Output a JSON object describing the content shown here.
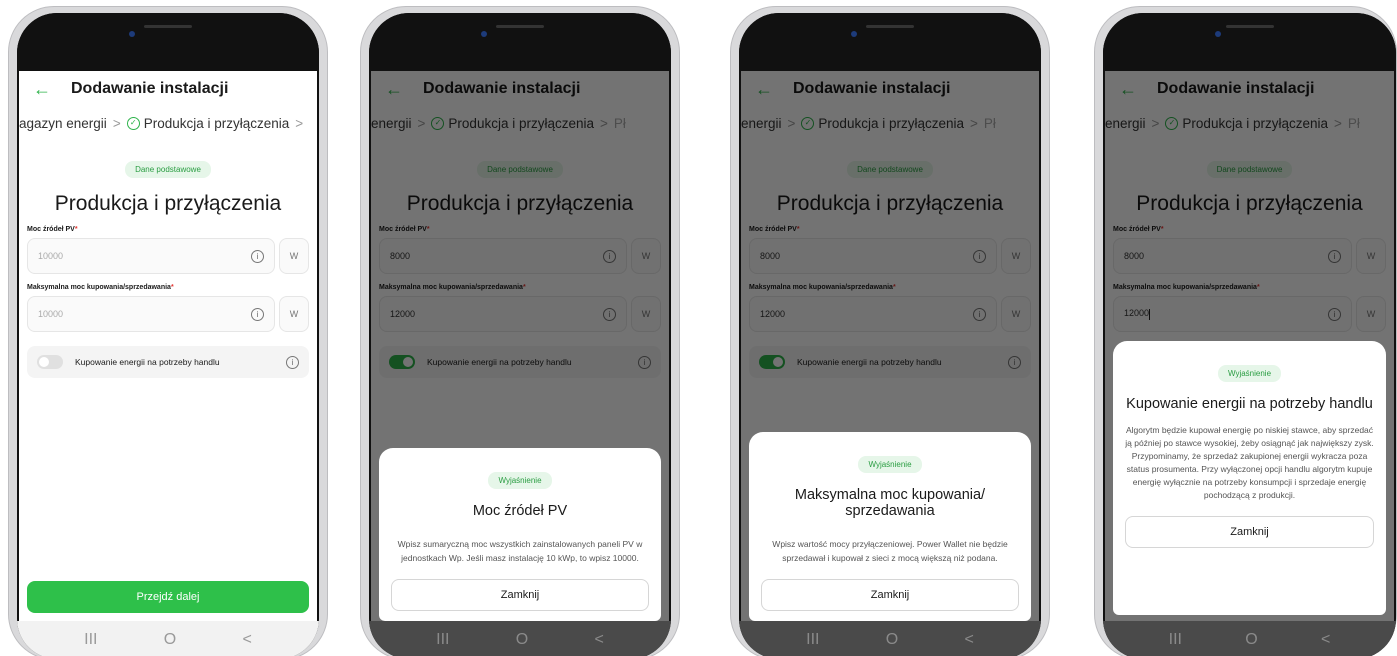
{
  "app": {
    "title": "Dodawanie instalacji",
    "back_icon": "arrow-left-icon",
    "accent": "#2db34a"
  },
  "breadcrumb": {
    "prev": "Magazyn energii",
    "prev_short_1": "agazyn energii",
    "prev_short_2": "energii",
    "current": "Produkcja i przyłączenia",
    "next_short": "Pł"
  },
  "form": {
    "badge": "Dane podstawowe",
    "heading": "Produkcja i przyłączenia",
    "pv_label": "Moc źródeł PV",
    "pv_placeholder": "10000",
    "pv_value": "8000",
    "max_label": "Maksymalna moc kupowania/sprzedawania",
    "max_placeholder": "10000",
    "max_value": "12000",
    "unit": "W",
    "toggle_label": "Kupowanie energii na potrzeby handlu",
    "next_button": "Przejdź dalej"
  },
  "nav": {
    "recent": "III",
    "home": "O",
    "back": "<"
  },
  "sheets": {
    "badge": "Wyjaśnienie",
    "close": "Zamknij",
    "pv": {
      "title": "Moc źródeł PV",
      "body": "Wpisz sumaryczną moc wszystkich zainstalowanych paneli PV w jednostkach Wp. Jeśli masz instalację 10 kWp, to wpisz 10000."
    },
    "max": {
      "title": "Maksymalna moc kupowania/ sprzedawania",
      "body": "Wpisz wartość mocy przyłączeniowej. Power Wallet nie będzie sprzedawał i kupował z sieci z mocą większą niż podana."
    },
    "trade": {
      "title": "Kupowanie energii na potrzeby handlu",
      "body": "Algorytm będzie kupował energię po niskiej stawce, aby sprzedać ją później po stawce wysokiej, żeby osiągnąć jak największy zysk. Przypominamy, że sprzedaż zakupionej energii wykracza poza status prosumenta. Przy wyłączonej opcji handlu algorytm kupuje energię wyłącznie na potrzeby konsumpcji i sprzedaje energię pochodzącą z produkcji."
    }
  }
}
